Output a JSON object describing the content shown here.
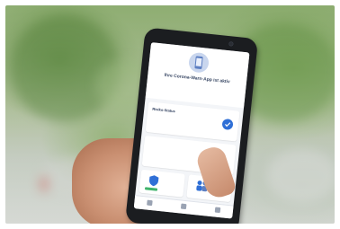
{
  "photo": {
    "subject": "hand-holding-smartphone",
    "background": "blurred-green-trees-street"
  },
  "app": {
    "header": {
      "title": "Ihre Corona-Warn-App ist aktiv",
      "subtitle": ""
    },
    "cards": [
      {
        "title": "Risiko-Status",
        "subtitle": ""
      },
      {
        "title": "",
        "subtitle": ""
      },
      {
        "title": "",
        "subtitle": ""
      },
      {
        "title": "",
        "subtitle": ""
      }
    ],
    "accent_color": "#2f6fd6",
    "status_color": "#3fb36b"
  }
}
